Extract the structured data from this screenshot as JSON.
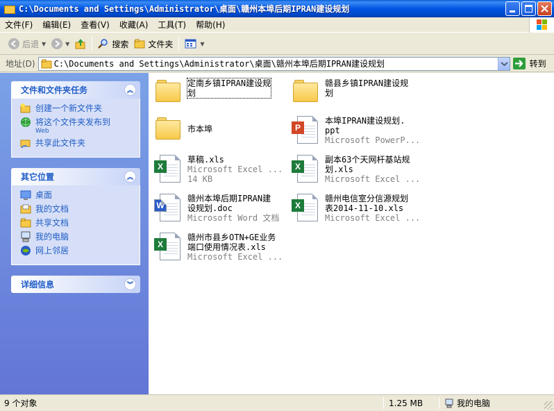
{
  "window": {
    "title": "C:\\Documents and Settings\\Administrator\\桌面\\赣州本埠后期IPRAN建设规划"
  },
  "menu": [
    "文件(F)",
    "编辑(E)",
    "查看(V)",
    "收藏(A)",
    "工具(T)",
    "帮助(H)"
  ],
  "toolbar": {
    "back": "后退",
    "search": "搜索",
    "folders": "文件夹"
  },
  "address": {
    "label": "地址(D)",
    "path": "C:\\Documents and Settings\\Administrator\\桌面\\赣州本埠后期IPRAN建设规划",
    "go": "转到"
  },
  "tasks": {
    "file_tasks": {
      "title": "文件和文件夹任务",
      "items": [
        {
          "label": "创建一个新文件夹",
          "icon": "new-folder-icon"
        },
        {
          "label": "将这个文件夹发布到",
          "sub": "Web",
          "icon": "publish-web-icon"
        },
        {
          "label": "共享此文件夹",
          "icon": "share-folder-icon"
        }
      ]
    },
    "other_places": {
      "title": "其它位置",
      "items": [
        {
          "label": "桌面",
          "icon": "desktop-icon"
        },
        {
          "label": "我的文档",
          "icon": "my-documents-icon"
        },
        {
          "label": "共享文档",
          "icon": "shared-documents-icon"
        },
        {
          "label": "我的电脑",
          "icon": "my-computer-icon"
        },
        {
          "label": "网上邻居",
          "icon": "network-icon"
        }
      ]
    },
    "details": {
      "title": "详细信息"
    }
  },
  "files": [
    {
      "name": "定南乡镇IPRAN建设规\n划",
      "type": "",
      "size": "",
      "kind": "folder"
    },
    {
      "name": "赣县乡镇IPRAN建设规\n划",
      "type": "",
      "size": "",
      "kind": "folder"
    },
    {
      "name": "市本埠",
      "type": "",
      "size": "",
      "kind": "folder"
    },
    {
      "name": "本埠IPRAN建设规划.\nppt",
      "type": "Microsoft PowerP...",
      "size": "",
      "kind": "ppt"
    },
    {
      "name": "草稿.xls",
      "type": "Microsoft Excel ...",
      "size": "14 KB",
      "kind": "xls"
    },
    {
      "name": "副本63个天网杆基站规\n划.xls",
      "type": "Microsoft Excel ...",
      "size": "",
      "kind": "xls"
    },
    {
      "name": "赣州本埠后期IPRAN建\n设规划.doc",
      "type": "Microsoft Word 文档",
      "size": "",
      "kind": "doc"
    },
    {
      "name": "赣州电信室分信源规划\n表2014-11-10.xls",
      "type": "Microsoft Excel ...",
      "size": "",
      "kind": "xls"
    },
    {
      "name": "赣州市县乡OTN+GE业务\n端口使用情况表.xls",
      "type": "Microsoft Excel ...",
      "size": "",
      "kind": "xls"
    }
  ],
  "status": {
    "count": "9 个对象",
    "size": "1.25 MB",
    "zone": "我的电脑"
  },
  "colors": {
    "title_bar": "#0054E3",
    "task_link": "#215DC6",
    "task_body": "#D6DFF7"
  }
}
